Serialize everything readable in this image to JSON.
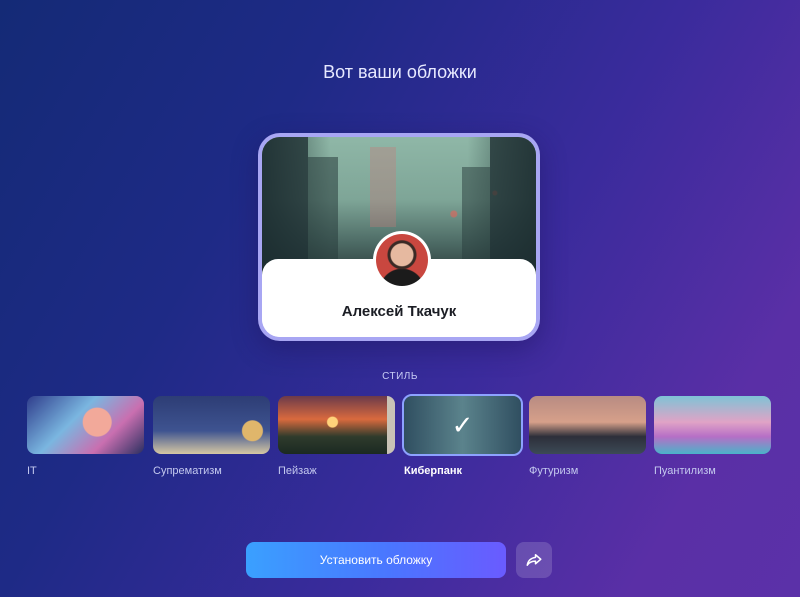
{
  "header": {
    "title": "Вот ваши обложки"
  },
  "preview": {
    "user_name": "Алексей Ткачук"
  },
  "styles": {
    "label": "СТИЛЬ",
    "items": [
      {
        "name": "IT"
      },
      {
        "name": "Супрематизм"
      },
      {
        "name": "Пейзаж"
      },
      {
        "name": "Киберпанк"
      },
      {
        "name": "Футуризм"
      },
      {
        "name": "Пуантилизм"
      }
    ],
    "selected": "Киберпанк",
    "selected_icon": "checkmark-icon"
  },
  "actions": {
    "install_label": "Установить обложку",
    "share_icon": "share-arrow-icon"
  },
  "colors": {
    "accent": "#4a76ff",
    "selected_outline": "#8da2ff"
  }
}
